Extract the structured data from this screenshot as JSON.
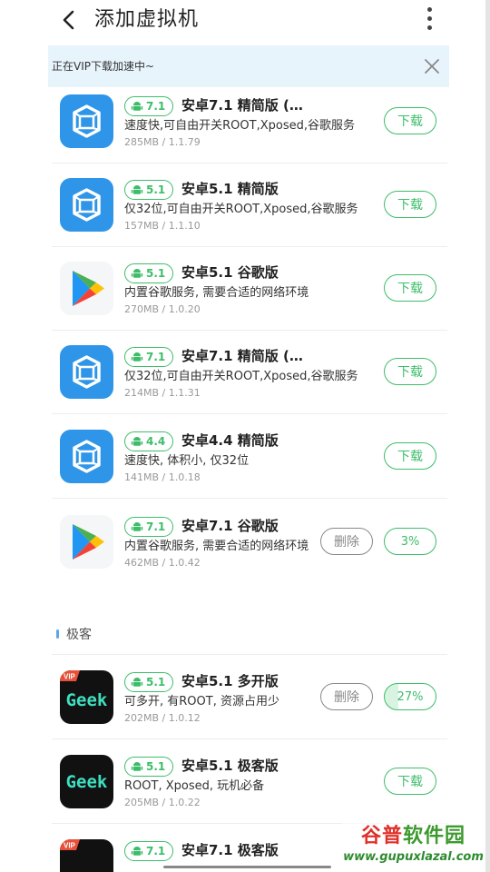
{
  "header": {
    "title": "添加虚拟机",
    "back_icon": "chevron-left-icon",
    "more_icon": "vertical-dots-icon"
  },
  "notice": {
    "text": "正在VIP下载加速中~",
    "close_icon": "close-icon"
  },
  "items": [
    {
      "icon": "vmos-cube-icon",
      "version": "7.1",
      "name": "安卓7.1 精简版 (…",
      "desc": "速度快,可自由开关ROOT,Xposed,谷歌服务",
      "meta": "285MB / 1.1.79",
      "action": "下载"
    },
    {
      "icon": "vmos-cube-icon",
      "version": "5.1",
      "name": "安卓5.1 精简版",
      "desc": "仅32位,可自由开关ROOT,Xposed,谷歌服务",
      "meta": "157MB / 1.1.10",
      "action": "下载"
    },
    {
      "icon": "google-play-icon",
      "version": "5.1",
      "name": "安卓5.1 谷歌版",
      "desc": "内置谷歌服务, 需要合适的网络环境",
      "meta": "270MB / 1.0.20",
      "action": "下载"
    },
    {
      "icon": "vmos-cube-icon",
      "version": "7.1",
      "name": "安卓7.1 精简版 (…",
      "desc": "仅32位,可自由开关ROOT,Xposed,谷歌服务",
      "meta": "214MB / 1.1.31",
      "action": "下载"
    },
    {
      "icon": "vmos-cube-icon",
      "version": "4.4",
      "name": "安卓4.4 精简版",
      "desc": "速度快, 体积小, 仅32位",
      "meta": "141MB / 1.0.18",
      "action": "下载"
    },
    {
      "icon": "google-play-icon",
      "version": "7.1",
      "name": "安卓7.1 谷歌版",
      "desc": "内置谷歌服务, 需要合适的网络环境",
      "meta": "462MB / 1.0.42",
      "delete": "删除",
      "action": "3%",
      "progress": 0.03
    }
  ],
  "section": {
    "label": "极客"
  },
  "geek_items": [
    {
      "icon": "geek-vip-icon",
      "badge": "VIP",
      "logo": "Geek",
      "version": "5.1",
      "name": "安卓5.1 多开版",
      "desc": "可多开, 有ROOT, 资源占用少",
      "meta": "202MB / 1.0.12",
      "delete": "删除",
      "action": "27%",
      "progress": 0.27
    },
    {
      "icon": "geek-icon",
      "logo": "Geek",
      "version": "5.1",
      "name": "安卓5.1 极客版",
      "desc": "ROOT, Xposed, 玩机必备",
      "meta": "205MB / 1.0.22",
      "action": "下载"
    },
    {
      "icon": "geek-vip-icon",
      "badge": "VIP",
      "version": "7.1",
      "name": "安卓7.1 极客版"
    }
  ],
  "watermark": {
    "part1": "谷普",
    "part2": "软件园",
    "url": "www.gupuxlazal.com"
  },
  "colors": {
    "accent": "#3dbd6a",
    "notice_bg": "#e8f4fc",
    "section_bar": "#5aa8e6"
  }
}
